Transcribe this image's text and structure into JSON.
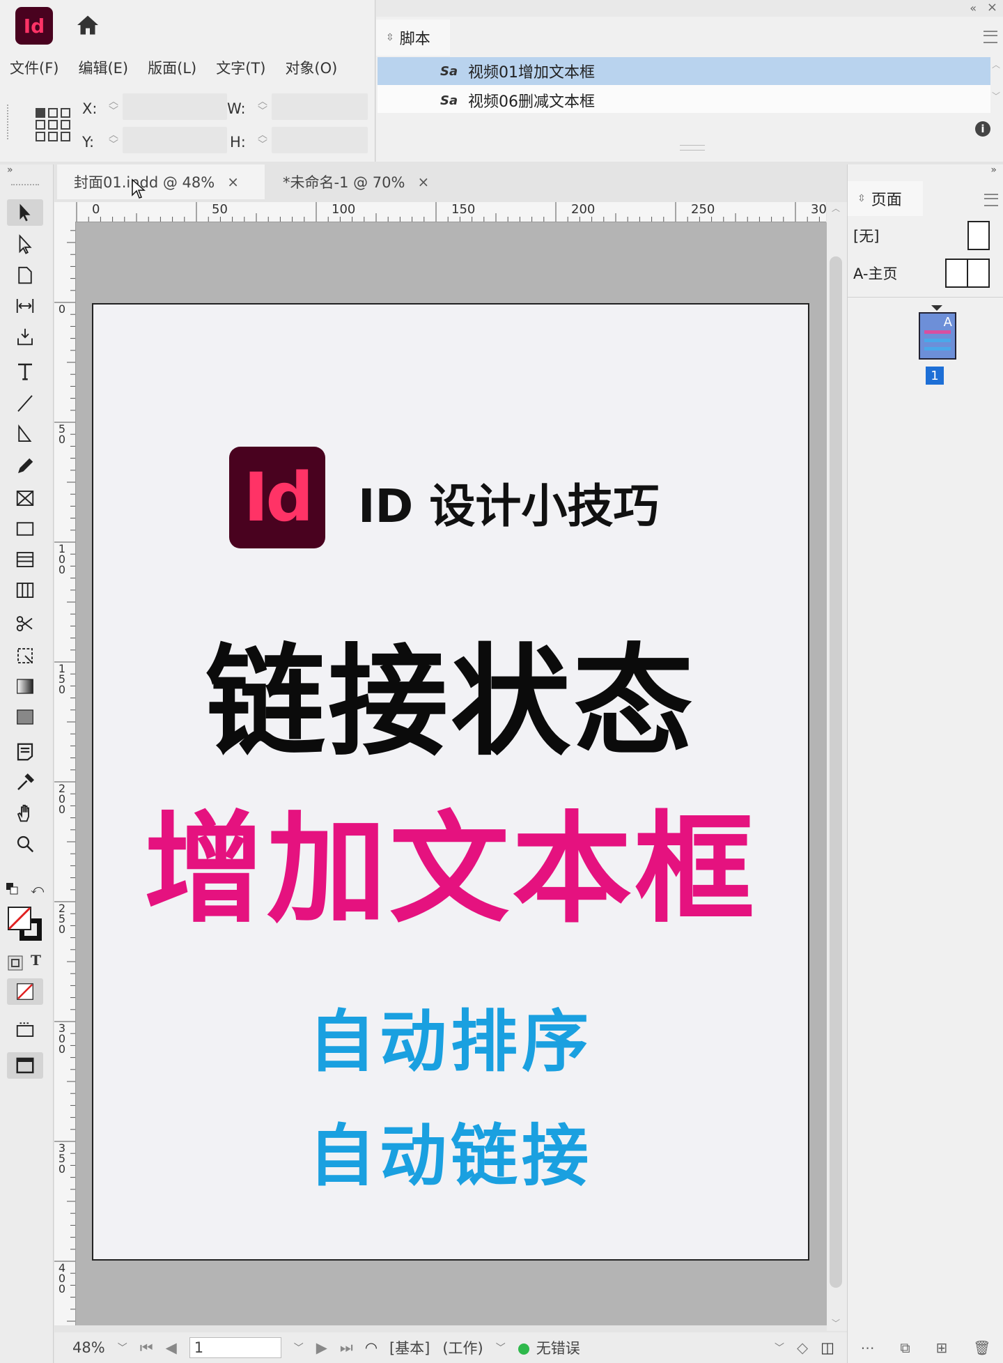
{
  "app": {
    "logo_text": "Id",
    "home_icon": "home-icon"
  },
  "menu": [
    "文件(F)",
    "编辑(E)",
    "版面(L)",
    "文字(T)",
    "对象(O)"
  ],
  "control": {
    "x_label": "X:",
    "y_label": "Y:",
    "w_label": "W:",
    "h_label": "H:"
  },
  "scripts_panel": {
    "tab_label": "脚本",
    "items": [
      {
        "label": "视频01增加文本框",
        "selected": true
      },
      {
        "label": "视频06删减文本框",
        "selected": false
      }
    ]
  },
  "doc_tabs": [
    {
      "label": "封面01.indd @ 48%",
      "close": "×",
      "active": true
    },
    {
      "label": "*未命名-1 @ 70%",
      "close": "×",
      "active": false
    }
  ],
  "ruler_h_labels": [
    "0",
    "50",
    "100",
    "150",
    "200",
    "250",
    "30"
  ],
  "ruler_v_labels": [
    "0",
    "5 0",
    "1 0 0",
    "1 5 0",
    "2 0 0",
    "2 5 0",
    "3 0 0",
    "3 5 0",
    "4 0 0"
  ],
  "page": {
    "badge_text": "Id",
    "subtitle": "ID 设计小技巧",
    "title_line1": "链接状态",
    "title_line2": "增加文本框",
    "feature1": "自动排序",
    "feature2": "自动链接"
  },
  "colors": {
    "brand_dark": "#49021f",
    "brand_pink": "#ff3366",
    "title_pink": "#e5127f",
    "feature_blue": "#1aa0e0",
    "selection": "#b9d3ee"
  },
  "status": {
    "zoom": "48%",
    "page_field": "1",
    "style1": "[基本]",
    "style2": "(工作)",
    "preflight": "无错误"
  },
  "pages_panel": {
    "tab_label": "页面",
    "masters": [
      {
        "label": "[无]"
      },
      {
        "label": "A-主页"
      }
    ],
    "page_thumb_master": "A",
    "page_number": "1"
  }
}
